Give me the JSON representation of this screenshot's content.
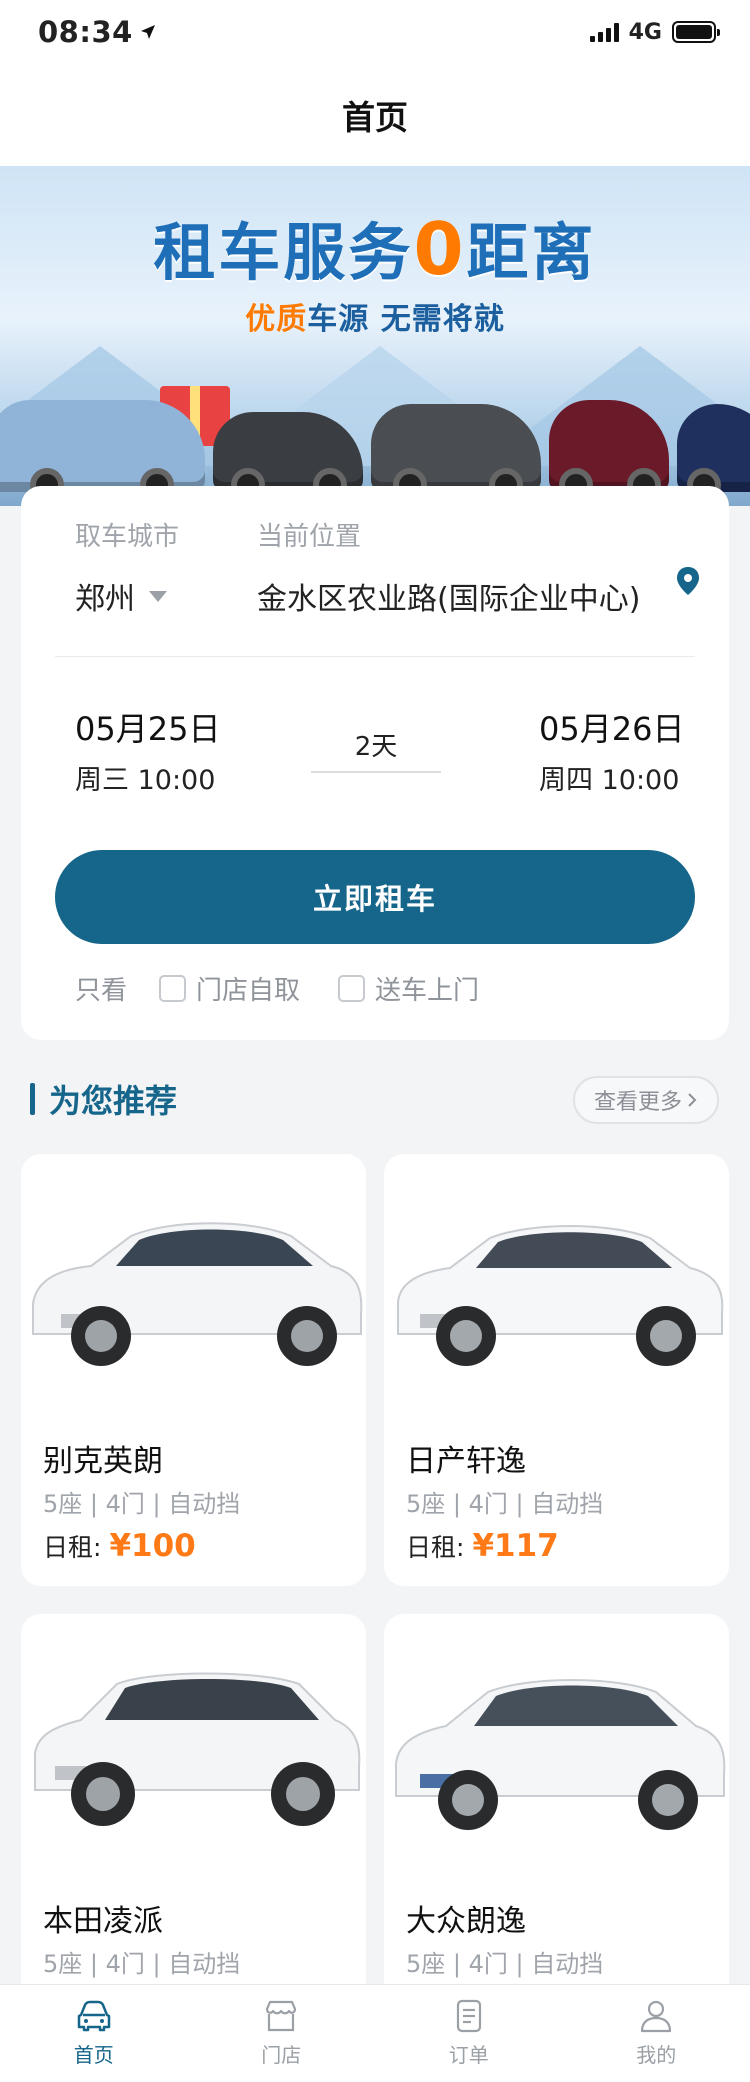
{
  "status": {
    "time": "08:34",
    "network": "4G"
  },
  "nav": {
    "title": "首页"
  },
  "banner": {
    "title_pre": "租车服务",
    "title_zero": "0",
    "title_post": "距离",
    "sub_highlight": "优质",
    "sub_rest": "车源 无需将就"
  },
  "booking": {
    "city_label": "取车城市",
    "city_value": "郑州",
    "location_label": "当前位置",
    "location_value": "金水区农业路(国际企业中心)",
    "pickup_date": "05月25日",
    "pickup_time": "周三 10:00",
    "duration": "2天",
    "return_date": "05月26日",
    "return_time": "周四 10:00",
    "rent_button": "立即租车",
    "filter_label": "只看",
    "filter_store": "门店自取",
    "filter_delivery": "送车上门"
  },
  "recommend": {
    "title": "为您推荐",
    "more": "查看更多"
  },
  "cars": [
    {
      "name": "别克英朗",
      "spec": "5座 | 4门 | 自动挡",
      "price_label": "日租:",
      "price": "¥100"
    },
    {
      "name": "日产轩逸",
      "spec": "5座 | 4门 | 自动挡",
      "price_label": "日租:",
      "price": "¥117"
    },
    {
      "name": "本田凌派",
      "spec": "5座 | 4门 | 自动挡"
    },
    {
      "name": "大众朗逸",
      "spec": "5座 | 4门 | 自动挡"
    }
  ],
  "tabs": [
    {
      "label": "首页",
      "icon": "car-icon",
      "active": true
    },
    {
      "label": "门店",
      "icon": "store-icon",
      "active": false
    },
    {
      "label": "订单",
      "icon": "order-icon",
      "active": false
    },
    {
      "label": "我的",
      "icon": "user-icon",
      "active": false
    }
  ],
  "colors": {
    "primary": "#16658a",
    "price": "#ff7a16",
    "banner_accent": "#ff7a00"
  }
}
